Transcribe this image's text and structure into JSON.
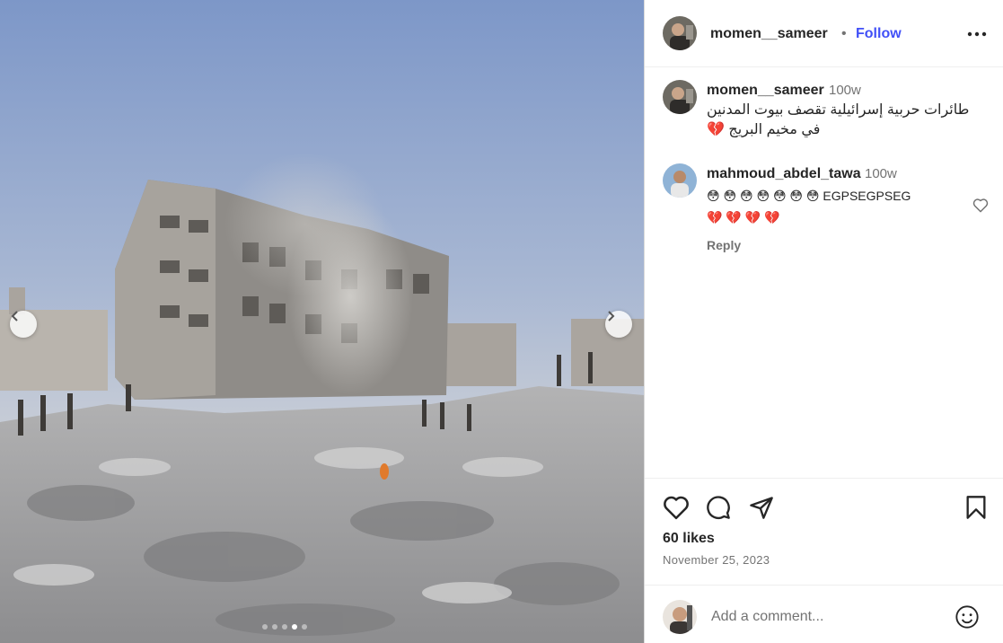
{
  "post": {
    "username": "momen__sameer",
    "separator": "•",
    "follow_label": "Follow"
  },
  "caption": {
    "username": "momen__sameer",
    "time": "100w",
    "line1": "طائرات حربية إسرائيلية تقصف بيوت المدنين",
    "line2": "في مخيم البريج 💔"
  },
  "comments": [
    {
      "username": "mahmoud_abdel_tawa",
      "time": "100w",
      "line1": "😳 😳 😳 😳 😳 😳 😳 EGPSEGPSEG",
      "line2": "💔 💔 💔 💔",
      "reply_label": "Reply"
    }
  ],
  "engagement": {
    "likes": "60 likes",
    "date": "November 25, 2023"
  },
  "add_comment": {
    "placeholder": "Add a comment..."
  },
  "carousel": {
    "slides": 5,
    "active_slide": 4
  },
  "colors": {
    "follow": "#4150f7",
    "text": "#262626",
    "secondary": "#737373",
    "border": "#dbdbdb"
  },
  "icons": [
    "chevron-left-icon",
    "chevron-right-icon",
    "more-horizontal-icon",
    "heart-icon",
    "comment-icon",
    "share-icon",
    "bookmark-icon",
    "emoji-icon"
  ]
}
